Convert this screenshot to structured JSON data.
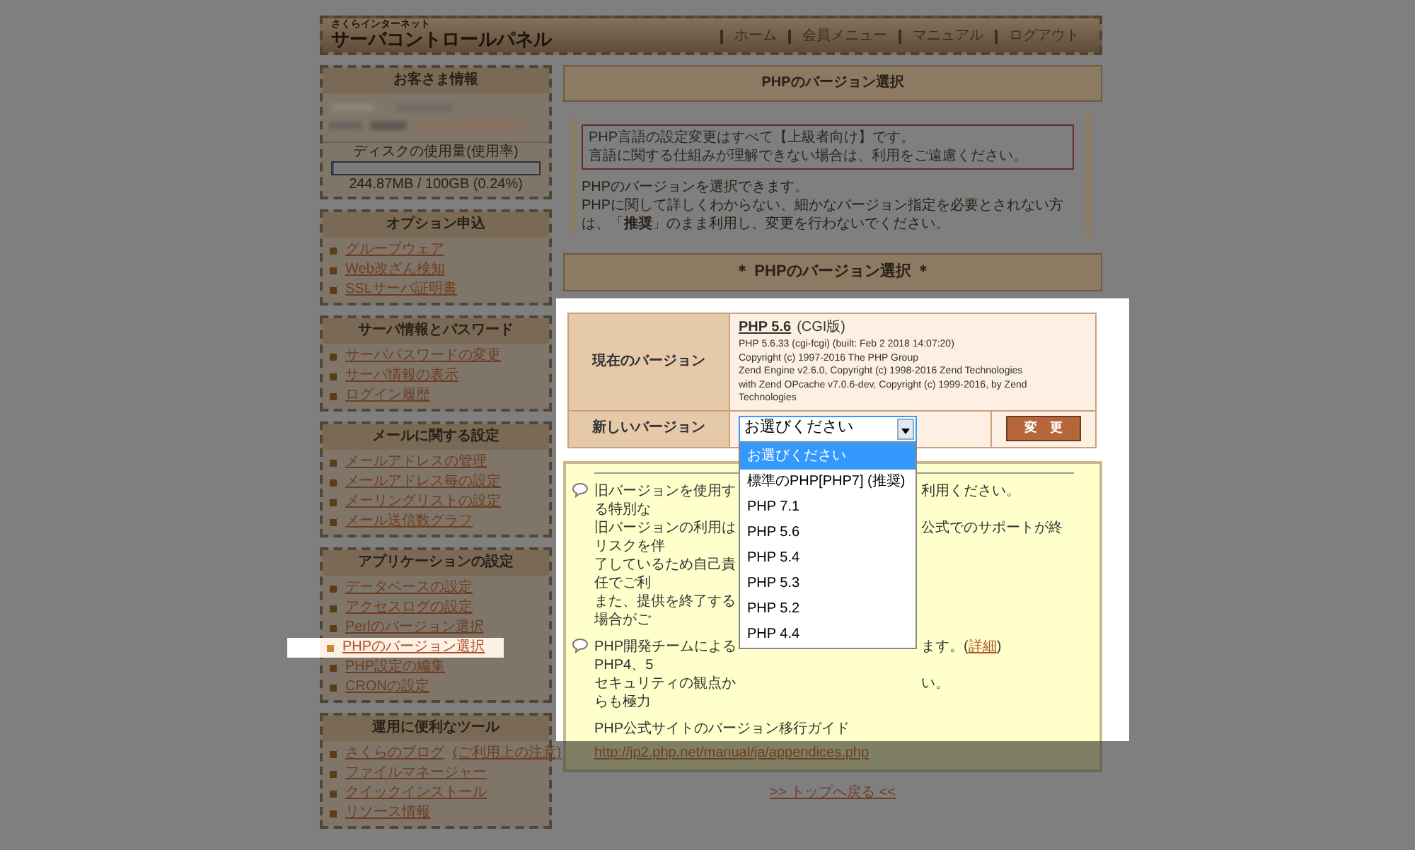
{
  "header": {
    "brand_small": "さくらインターネット",
    "brand": "サーバコントロールパネル",
    "nav": [
      "ホーム",
      "会員メニュー",
      "マニュアル",
      "ログアウト"
    ]
  },
  "sidebar": [
    {
      "kind": "account",
      "title": "お客さま情報",
      "disk_label": "ディスクの使用量(使用率)",
      "disk": {
        "level": 0.0024
      },
      "disk_reading": "244.87MB / 100GB (0.24%)"
    },
    {
      "kind": "links",
      "title": "オプション申込",
      "items": [
        {
          "label": "グループウェア",
          "selected": false
        },
        {
          "label": "Web改ざん検知",
          "selected": false
        },
        {
          "label": "SSLサーバ証明書",
          "selected": false
        }
      ]
    },
    {
      "kind": "links",
      "title": "サーバ情報とパスワード",
      "items": [
        {
          "label": "サーバパスワードの変更",
          "selected": false
        },
        {
          "label": "サーバ情報の表示",
          "selected": false
        },
        {
          "label": "ログイン履歴",
          "selected": false
        }
      ]
    },
    {
      "kind": "links",
      "title": "メールに関する設定",
      "items": [
        {
          "label": "メールアドレスの管理",
          "selected": false
        },
        {
          "label": "メールアドレス毎の設定",
          "selected": false
        },
        {
          "label": "メーリングリストの設定",
          "selected": false
        },
        {
          "label": "メール送信数グラフ",
          "selected": false
        }
      ]
    },
    {
      "kind": "links",
      "title": "アプリケーションの設定",
      "items": [
        {
          "label": "データベースの設定",
          "selected": false
        },
        {
          "label": "アクセスログの設定",
          "selected": false
        },
        {
          "label": "Perlのバージョン選択",
          "selected": false
        },
        {
          "label": "PHPのバージョン選択",
          "selected": true
        },
        {
          "label": "PHP設定の編集",
          "selected": false
        },
        {
          "label": "CRONの設定",
          "selected": false
        }
      ]
    },
    {
      "kind": "links",
      "title": "運用に便利なツール",
      "items": [
        {
          "label": "さくらのブログ",
          "note": "(ご利用上の注意)",
          "selected": false
        },
        {
          "label": "ファイルマネージャー",
          "selected": false
        },
        {
          "label": "クイックインストール",
          "selected": false
        },
        {
          "label": "リソース情報",
          "selected": false
        }
      ]
    }
  ],
  "page_title": "PHPのバージョン選択",
  "notice": {
    "warning": [
      "PHP言語の設定変更はすべて【上級者向け】です。",
      "言語に関する仕組みが理解できない場合は、利用をご遠慮ください。"
    ],
    "intro": [
      "PHPのバージョンを選択できます。",
      "PHPに関して詳しくわからない、細かなバージョン指定を必要とされない方は、「**推奨**」のまま利用し、変更を行わないでください。"
    ]
  },
  "section_title": "＊ PHPのバージョン選択 ＊",
  "version_table": {
    "current_label": "現在のバージョン",
    "current_version": "PHP 5.6",
    "current_type": "(CGI版)",
    "details": [
      "PHP 5.6.33 (cgi-fcgi) (built: Feb 2 2018 14:07:20)",
      "Copyright (c) 1997-2016 The PHP Group",
      "Zend Engine v2.6.0, Copyright (c) 1998-2016 Zend Technologies",
      "with Zend OPcache v7.0.6-dev, Copyright (c) 1999-2016, by Zend Technologies"
    ],
    "new_label": "新しいバージョン",
    "select": {
      "value": "お選びください",
      "expanded": true,
      "options": [
        {
          "label": "お選びください",
          "selected": true
        },
        {
          "label": "標準のPHP[PHP7] (推奨)",
          "selected": false
        },
        {
          "label": "PHP 7.1",
          "selected": false
        },
        {
          "label": "PHP 5.6",
          "selected": false
        },
        {
          "label": "PHP 5.4",
          "selected": false
        },
        {
          "label": "PHP 5.3",
          "selected": false
        },
        {
          "label": "PHP 5.2",
          "selected": false
        },
        {
          "label": "PHP 4.4",
          "selected": false
        }
      ]
    },
    "submit": "変　更"
  },
  "notes": [
    {
      "lines": [
        {
          "left": "旧バージョンを使用する特別な",
          "right": "利用ください。"
        },
        {
          "left": "旧バージョンの利用はリスクを伴",
          "right": "公式でのサポートが終"
        },
        {
          "left": "了しているため自己責任でご利"
        },
        {
          "left": "また、提供を終了する場合がご"
        }
      ]
    },
    {
      "lines": [
        {
          "left": "PHP開発チームによるPHP4、5",
          "right": "ます。(",
          "link": "詳細",
          "after": ")"
        },
        {
          "left": "セキュリティの観点からも極力",
          "right": "い。"
        }
      ]
    }
  ],
  "guide_label": "PHP公式サイトのバージョン移行ガイド",
  "guide_url": "http://jp2.php.net/manual/ja/appendices.php",
  "back_link": ">> トップへ戻る <<"
}
